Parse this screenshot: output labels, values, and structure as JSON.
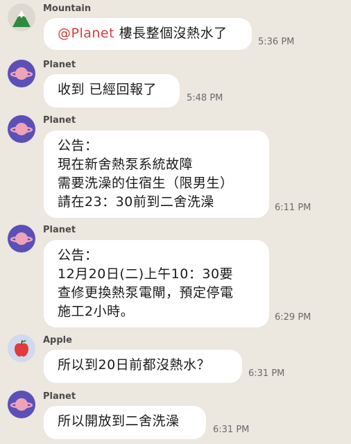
{
  "messages": [
    {
      "sender": "Mountain",
      "avatar": "mountain-icon",
      "mention": "@Planet",
      "text": " 樓長整個沒熱水了",
      "time": "5:36 PM"
    },
    {
      "sender": "Planet",
      "avatar": "planet-icon",
      "text": "收到 已經回報了",
      "time": "5:48 PM"
    },
    {
      "sender": "Planet",
      "avatar": "planet-icon",
      "text": "公告：\n現在新舍熱泵系統故障\n需要洗澡的住宿生（限男生）\n請在23：30前到二舍洗澡",
      "time": "6:11 PM"
    },
    {
      "sender": "Planet",
      "avatar": "planet-icon",
      "text": "公告：\n12月20日(二)上午10：30要\n查修更換熱泵電閘，預定停電\n施工2小時。",
      "time": "6:29 PM"
    },
    {
      "sender": "Apple",
      "avatar": "apple-icon",
      "text": "所以到20日前都沒熱水？",
      "time": "6:31 PM"
    },
    {
      "sender": "Planet",
      "avatar": "planet-icon",
      "text": "所以開放到二舍洗澡",
      "time": "6:31 PM"
    }
  ],
  "colors": {
    "background": "#ece7df",
    "bubble": "#ffffff",
    "mention": "#d73b3b",
    "planet_avatar_bg": "#5b50b8",
    "planet_body": "#f0a3b6",
    "mountain_avatar_bg": "#ddd9d0",
    "mountain_green": "#2e8b3e",
    "apple_avatar_bg": "#cfd9ef",
    "apple_red": "#e03a3a"
  }
}
